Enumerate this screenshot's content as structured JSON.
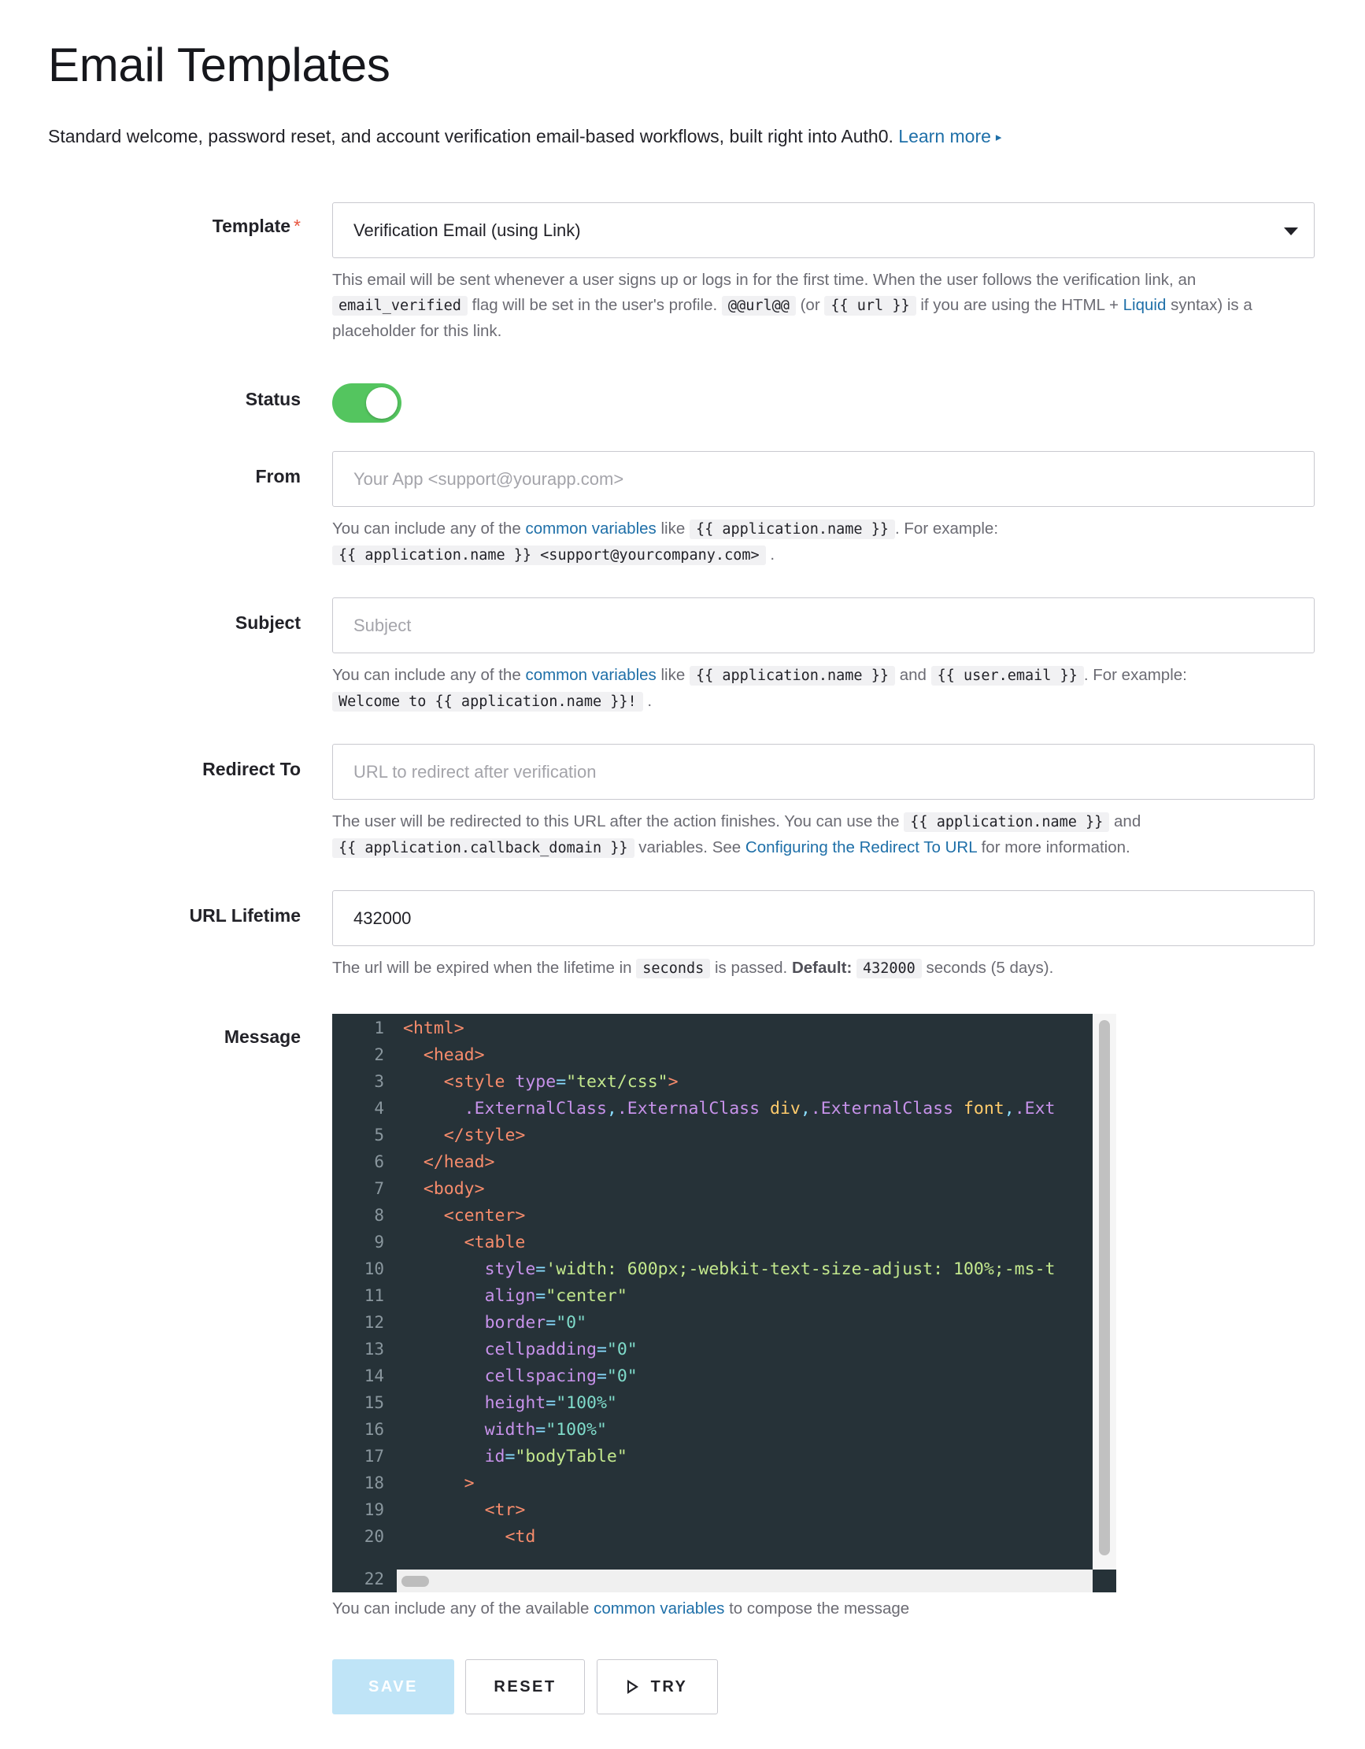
{
  "page": {
    "title": "Email Templates",
    "intro": "Standard welcome, password reset, and account verification email-based workflows, built right into Auth0.",
    "learn_more": "Learn more",
    "learn_more_arrow": "▸"
  },
  "form": {
    "template": {
      "label": "Template",
      "required_mark": "*",
      "value": "Verification Email (using Link)",
      "help": {
        "t1": "This email will be sent whenever a user signs up or logs in for the first time. When the user follows the verification link, an",
        "c1": "email_verified",
        "t2": "flag will be set in the user's profile.",
        "c2": "@@url@@",
        "t3": "(or",
        "c3": "{{ url }}",
        "t4": "if you are using the HTML +",
        "link": "Liquid",
        "t5": "syntax) is a placeholder for this link."
      }
    },
    "status": {
      "label": "Status",
      "enabled": true
    },
    "from": {
      "label": "From",
      "placeholder": "Your App <support@yourapp.com>",
      "help": {
        "t1": "You can include any of the",
        "link": "common variables",
        "t2": "like",
        "c1": "{{ application.name }}",
        "t3": ". For example:",
        "c2": "{{ application.name }} <support@yourcompany.com>",
        "t4": "."
      }
    },
    "subject": {
      "label": "Subject",
      "placeholder": "Subject",
      "help": {
        "t1": "You can include any of the",
        "link": "common variables",
        "t2": "like",
        "c1": "{{ application.name }}",
        "t3": "and",
        "c2": "{{ user.email }}",
        "t4": ". For example:",
        "c3": "Welcome to {{ application.name }}!",
        "t5": "."
      }
    },
    "redirect": {
      "label": "Redirect To",
      "placeholder": "URL to redirect after verification",
      "help": {
        "t1": "The user will be redirected to this URL after the action finishes. You can use the",
        "c1": "{{ application.name }}",
        "t2": "and",
        "c2": "{{ application.callback_domain }}",
        "t3": "variables. See",
        "link": "Configuring the Redirect To URL",
        "t4": "for more information."
      }
    },
    "lifetime": {
      "label": "URL Lifetime",
      "value": "432000",
      "help": {
        "t1": "The url will be expired when the lifetime in",
        "c1": "seconds",
        "t2": "is passed.",
        "bold": "Default:",
        "c2": "432000",
        "t3": "seconds (5 days)."
      }
    },
    "message": {
      "label": "Message",
      "help": {
        "t1": "You can include any of the available",
        "link": "common variables",
        "t2": "to compose the message"
      }
    }
  },
  "editor": {
    "line_numbers": [
      "1",
      "2",
      "3",
      "4",
      "5",
      "6",
      "7",
      "8",
      "9",
      "10",
      "11",
      "12",
      "13",
      "14",
      "15",
      "16",
      "17",
      "18",
      "19",
      "20"
    ],
    "partial_line_number": "22",
    "lines": [
      [
        "<html>"
      ],
      [
        "  ",
        "<head>"
      ],
      [
        "    ",
        "<style",
        " type",
        "=",
        "\"text/css\"",
        ">"
      ],
      [
        "      ",
        ".ExternalClass",
        ",",
        ".ExternalClass",
        " div",
        ",",
        ".ExternalClass",
        " font",
        ",",
        ".Ext"
      ],
      [
        "    ",
        "</style>"
      ],
      [
        "  ",
        "</head>"
      ],
      [
        "  ",
        "<body>"
      ],
      [
        "    ",
        "<center>"
      ],
      [
        "      ",
        "<table"
      ],
      [
        "        ",
        "style",
        "=",
        "'width: 600px;-webkit-text-size-adjust: 100%;-ms-t"
      ],
      [
        "        ",
        "align",
        "=",
        "\"center\""
      ],
      [
        "        ",
        "border",
        "=",
        "\"0\""
      ],
      [
        "        ",
        "cellpadding",
        "=",
        "\"0\""
      ],
      [
        "        ",
        "cellspacing",
        "=",
        "\"0\""
      ],
      [
        "        ",
        "height",
        "=",
        "\"100%\""
      ],
      [
        "        ",
        "width",
        "=",
        "\"100%\""
      ],
      [
        "        ",
        "id",
        "=",
        "\"bodyTable\""
      ],
      [
        "      ",
        ">"
      ],
      [
        "        ",
        "<tr>"
      ],
      [
        "          ",
        "<td"
      ]
    ]
  },
  "actions": {
    "save": "SAVE",
    "reset": "RESET",
    "try": "TRY"
  },
  "colors": {
    "accent_link": "#1e6fa8",
    "toggle_on": "#54c55f",
    "save_disabled": "#bfe4f7",
    "editor_bg": "#263238",
    "required": "#e8553e"
  },
  "icons": {
    "select_caret": "chevron-down-icon",
    "try_button": "play-icon"
  }
}
